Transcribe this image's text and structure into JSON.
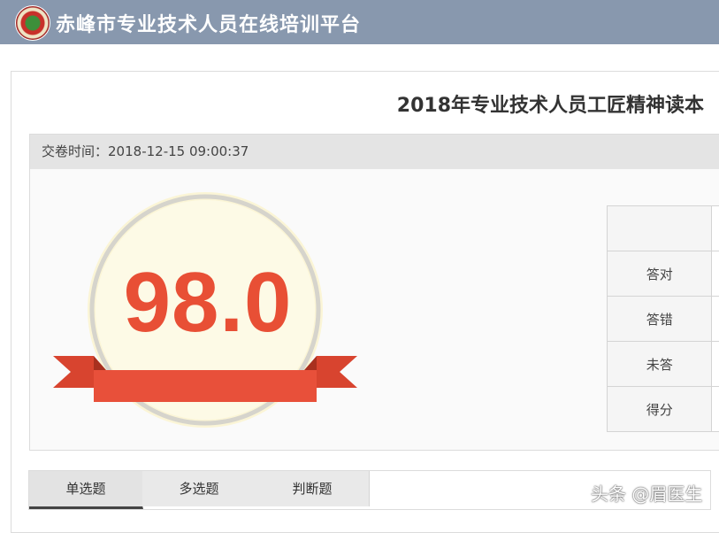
{
  "header": {
    "site_title": "赤峰市专业技术人员在线培训平台"
  },
  "exam": {
    "title": "2018年专业技术人员工匠精神读本",
    "submit_time_label": "交卷时间：",
    "submit_time": "2018-12-15 09:00:37",
    "score": "98.0"
  },
  "stats": {
    "rows": [
      {
        "label": "答对"
      },
      {
        "label": "答错"
      },
      {
        "label": "未答"
      },
      {
        "label": "得分"
      }
    ]
  },
  "tabs": [
    {
      "label": "单选题",
      "active": true
    },
    {
      "label": "多选题",
      "active": false
    },
    {
      "label": "判断题",
      "active": false
    }
  ],
  "watermark": "头条 @眉医生",
  "colors": {
    "header_bg": "#8898ae",
    "score_red": "#e84f35",
    "medal_cream": "#fdf9df",
    "ribbon_red": "#e8503a"
  }
}
